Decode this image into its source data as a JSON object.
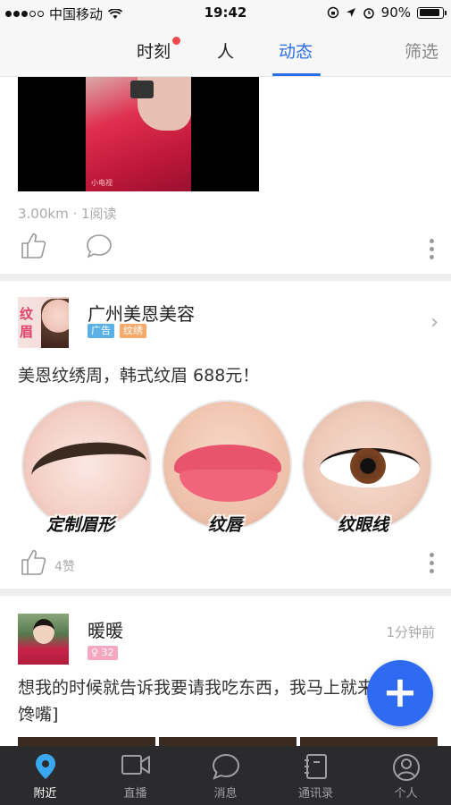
{
  "status_bar": {
    "carrier": "中国移动",
    "time": "19:42",
    "battery": "90%",
    "battery_level": 0.9
  },
  "top_nav": {
    "tabs": [
      {
        "label": "时刻",
        "active": false,
        "has_dot": true
      },
      {
        "label": "人",
        "active": false
      },
      {
        "label": "动态",
        "active": true
      }
    ],
    "filter_label": "筛选"
  },
  "feed": {
    "post1": {
      "meta": "3.00km · 1阅读",
      "video_watermark": "小电视"
    },
    "ad_post": {
      "avatar_text": [
        "纹",
        "眉"
      ],
      "name": "广州美恩美容",
      "tags": [
        "广告",
        "纹绣"
      ],
      "text": "美恩纹绣周，韩式纹眉 688元！",
      "images": [
        {
          "label": "定制眉形",
          "icon": "eyebrow-image"
        },
        {
          "label": "纹唇",
          "icon": "lips-image"
        },
        {
          "label": "纹眼线",
          "icon": "eyeliner-image"
        }
      ],
      "likes": "4赞"
    },
    "post3": {
      "name": "暖暖",
      "badge": "♀ 32",
      "time": "1分钟前",
      "text": "想我的时候就告诉我要请我吃东西，我马上就来",
      "text_line2": "馋嘴]"
    }
  },
  "fab": {
    "label": "+",
    "color": "#2f6bf2"
  },
  "tab_bar": {
    "items": [
      {
        "label": "附近",
        "icon": "location-pin-icon",
        "active": true
      },
      {
        "label": "直播",
        "icon": "video-camera-icon",
        "active": false
      },
      {
        "label": "消息",
        "icon": "chat-bubble-icon",
        "active": false
      },
      {
        "label": "通讯录",
        "icon": "contacts-book-icon",
        "active": false
      },
      {
        "label": "个人",
        "icon": "person-icon",
        "active": false
      }
    ]
  },
  "colors": {
    "accent": "#2a6fe8",
    "tab_bar_bg": "#2b2b2e",
    "notification_dot": "#f04848"
  }
}
